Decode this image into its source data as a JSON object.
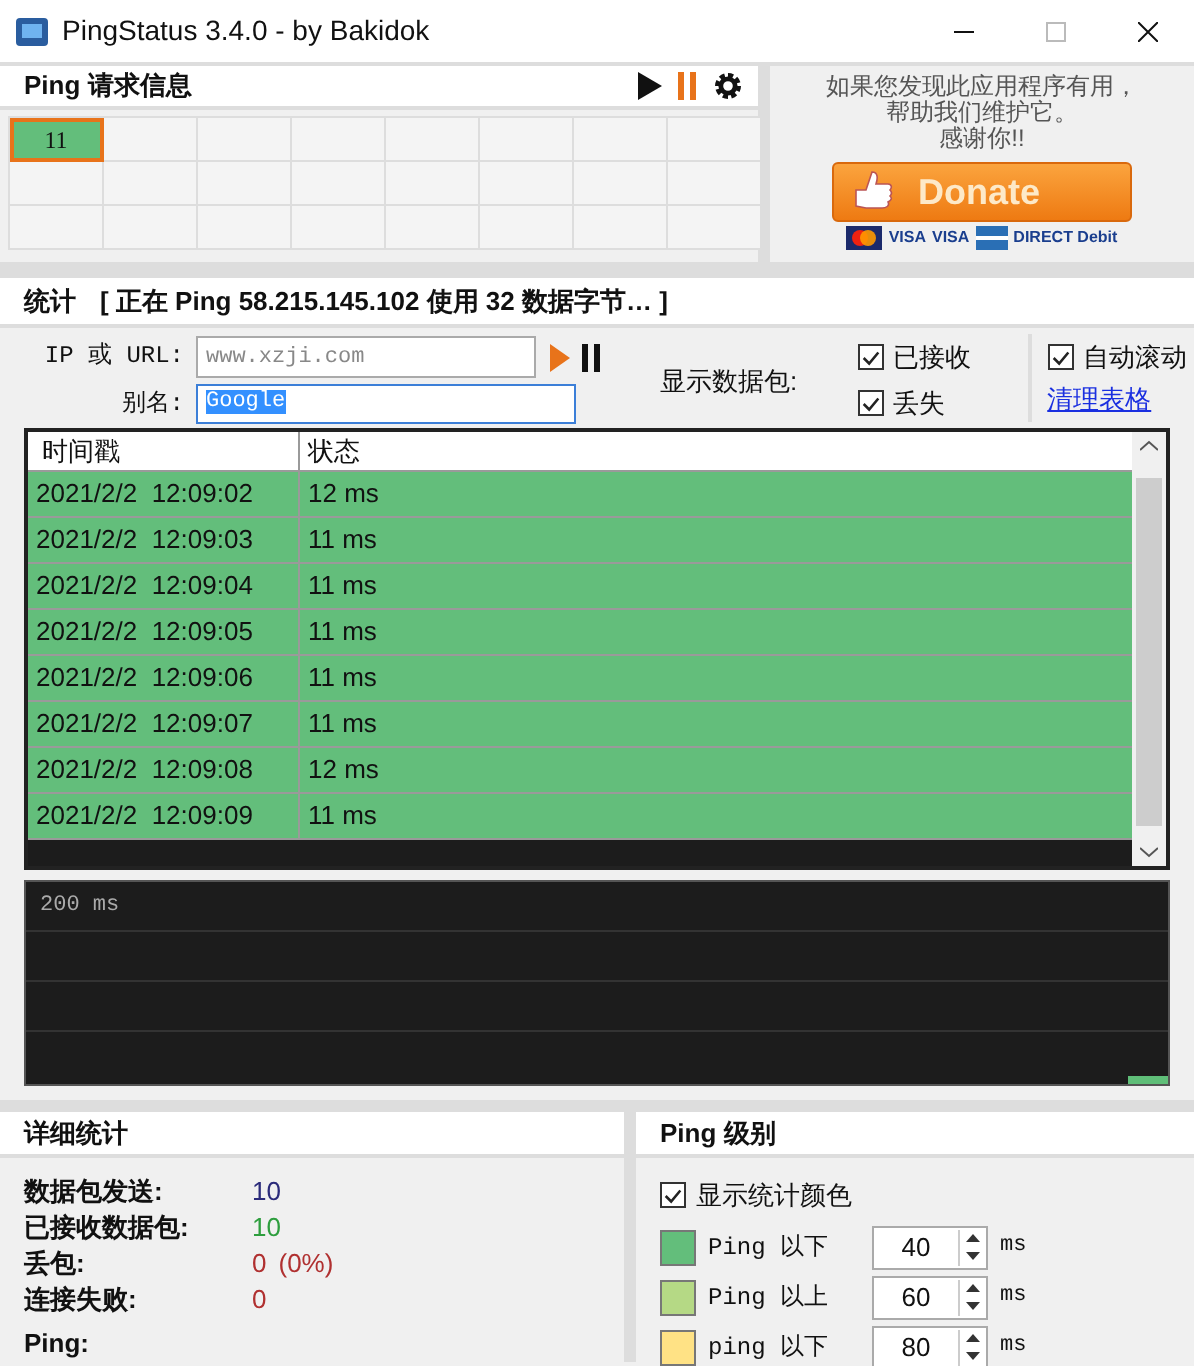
{
  "window": {
    "title": "PingStatus 3.4.0 - by Bakidok"
  },
  "request_panel": {
    "title": "Ping 请求信息",
    "cells": [
      {
        "value": "11",
        "color": "#63be7b",
        "selected": true
      }
    ]
  },
  "donation": {
    "message": [
      "如果您发现此应用程序有用，",
      "帮助我们维护它。",
      "感谢你!!"
    ],
    "button": "Donate",
    "payment_marks": [
      "VISA",
      "VISA",
      "DIRECT Debit"
    ]
  },
  "stats": {
    "title": "统计",
    "status": "[ 正在 Ping 58.215.145.102 使用 32 数据字节… ]"
  },
  "target": {
    "ip_label": "IP 或 URL:",
    "ip_placeholder": "www.xzji.com",
    "alias_label": "别名:",
    "alias_value": "Google"
  },
  "show_packets": {
    "label": "显示数据包:",
    "options": [
      {
        "label": "已接收",
        "checked": true
      },
      {
        "label": "丢失",
        "checked": true
      }
    ]
  },
  "auto_scroll": {
    "label": "自动滚动",
    "checked": true
  },
  "clear_link": "清理表格",
  "table": {
    "columns": [
      "时间戳",
      "状态"
    ],
    "rows": [
      {
        "time": "2021/2/2  12:09:02",
        "status": "12 ms",
        "color": "#63be7b"
      },
      {
        "time": "2021/2/2  12:09:03",
        "status": "11 ms",
        "color": "#63be7b"
      },
      {
        "time": "2021/2/2  12:09:04",
        "status": "11 ms",
        "color": "#63be7b"
      },
      {
        "time": "2021/2/2  12:09:05",
        "status": "11 ms",
        "color": "#63be7b"
      },
      {
        "time": "2021/2/2  12:09:06",
        "status": "11 ms",
        "color": "#63be7b"
      },
      {
        "time": "2021/2/2  12:09:07",
        "status": "11 ms",
        "color": "#63be7b"
      },
      {
        "time": "2021/2/2  12:09:08",
        "status": "12 ms",
        "color": "#63be7b"
      },
      {
        "time": "2021/2/2  12:09:09",
        "status": "11 ms",
        "color": "#63be7b"
      }
    ]
  },
  "graph": {
    "label": "200 ms"
  },
  "details": {
    "title": "详细统计",
    "items": [
      {
        "label": "数据包发送:",
        "value": "10",
        "color": "#2b2b7a"
      },
      {
        "label": "已接收数据包:",
        "value": "10",
        "color": "#2e9e3e"
      },
      {
        "label": "丢包:",
        "value": "0",
        "extra": "(0%)",
        "color": "#b03030"
      },
      {
        "label": "连接失败:",
        "value": "0",
        "color": "#b03030"
      }
    ],
    "ping_label": "Ping:"
  },
  "levels": {
    "title": "Ping 级别",
    "show_colors": {
      "label": "显示统计颜色",
      "checked": true
    },
    "rows": [
      {
        "label": "Ping 以下",
        "value": "40",
        "unit": "ms",
        "color": "#63be7b"
      },
      {
        "label": "Ping 以上",
        "value": "60",
        "unit": "ms",
        "color": "#b5d985"
      },
      {
        "label": "ping 以下",
        "value": "80",
        "unit": "ms",
        "color": "#ffe285"
      }
    ]
  }
}
